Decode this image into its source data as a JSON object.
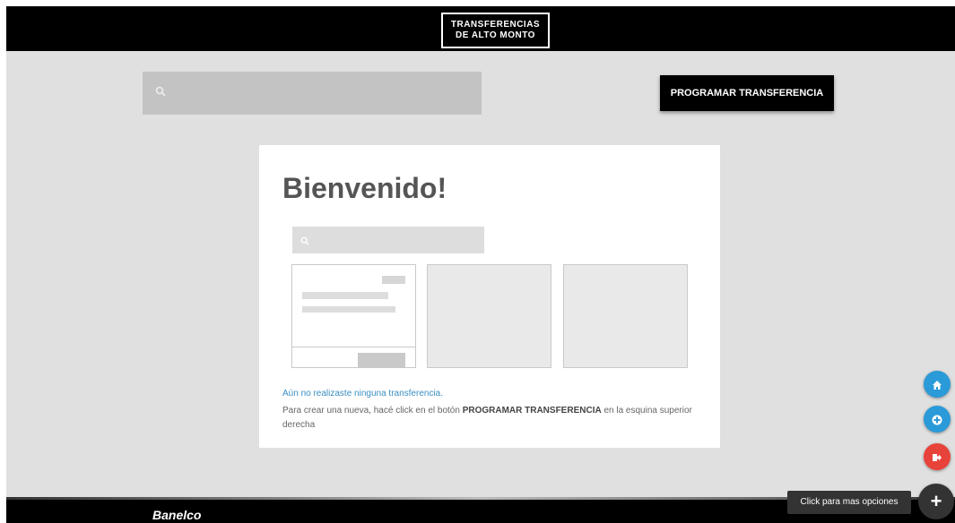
{
  "header": {
    "logo_line1": "TRANSFERENCIAS",
    "logo_line2": "DE ALTO MONTO"
  },
  "toolbar": {
    "search_placeholder": "",
    "program_button": "PROGRAMAR TRANSFERENCIA"
  },
  "welcome": {
    "title": "Bienvenido!",
    "empty_message": "Aún no realizaste ninguna transferencia.",
    "instruction_prefix": "Para crear una nueva, hacé click en el botón ",
    "instruction_bold": "PROGRAMAR TRANSFERENCIA",
    "instruction_suffix": " en la esquina superior derecha"
  },
  "footer": {
    "brand": "Banelco"
  },
  "fabs": {
    "tooltip": "Click para mas opciones",
    "main_symbol": "+",
    "home_icon": "home-icon",
    "add_icon": "plus-circle-icon",
    "exit_icon": "logout-icon"
  },
  "colors": {
    "accent_blue": "#2b9ad8",
    "danger_red": "#e8433a",
    "bar_black": "#000000"
  }
}
